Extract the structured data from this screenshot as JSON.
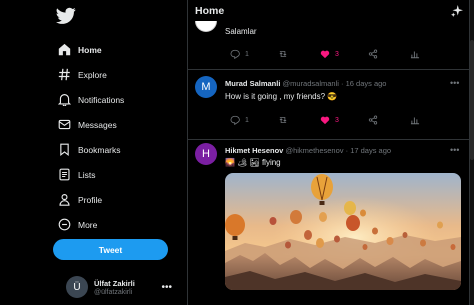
{
  "sidebar": {
    "logo": "twitter-bird-icon",
    "nav": [
      {
        "label": "Home",
        "icon": "home-icon",
        "active": true
      },
      {
        "label": "Explore",
        "icon": "hashtag-icon"
      },
      {
        "label": "Notifications",
        "icon": "bell-icon"
      },
      {
        "label": "Messages",
        "icon": "envelope-icon"
      },
      {
        "label": "Bookmarks",
        "icon": "bookmark-icon"
      },
      {
        "label": "Lists",
        "icon": "list-icon"
      },
      {
        "label": "Profile",
        "icon": "person-icon"
      },
      {
        "label": "More",
        "icon": "more-circle-icon"
      }
    ],
    "tweet_button": "Tweet",
    "account": {
      "avatar_letter": "Ü",
      "name": "Ülfat Zakirli",
      "handle": "@ülfatzakirli",
      "more": "•••"
    }
  },
  "header": {
    "title": "Home"
  },
  "tweets": [
    {
      "text": "Salamlar",
      "actions": {
        "replies": "1",
        "retweets": "",
        "likes": "3"
      }
    },
    {
      "avatar_letter": "M",
      "avatar_color": "#1565c0",
      "name": "Murad Salmanli",
      "handle": "@muradsalmanli",
      "time": "16 days ago",
      "text": "How is it going , my friends? 😎",
      "more": "•••",
      "actions": {
        "replies": "1",
        "retweets": "",
        "likes": "3"
      }
    },
    {
      "avatar_letter": "H",
      "avatar_color": "#7b1fa2",
      "name": "Hikmet Hesenov",
      "handle": "@hikmethesenov",
      "time": "17 days ago",
      "text": "🌄 🏕 🏜 flying",
      "more": "•••"
    }
  ],
  "colors": {
    "accent": "#1d9bf0",
    "like": "#f91880",
    "muted": "#71767b",
    "border": "#2f3336"
  }
}
